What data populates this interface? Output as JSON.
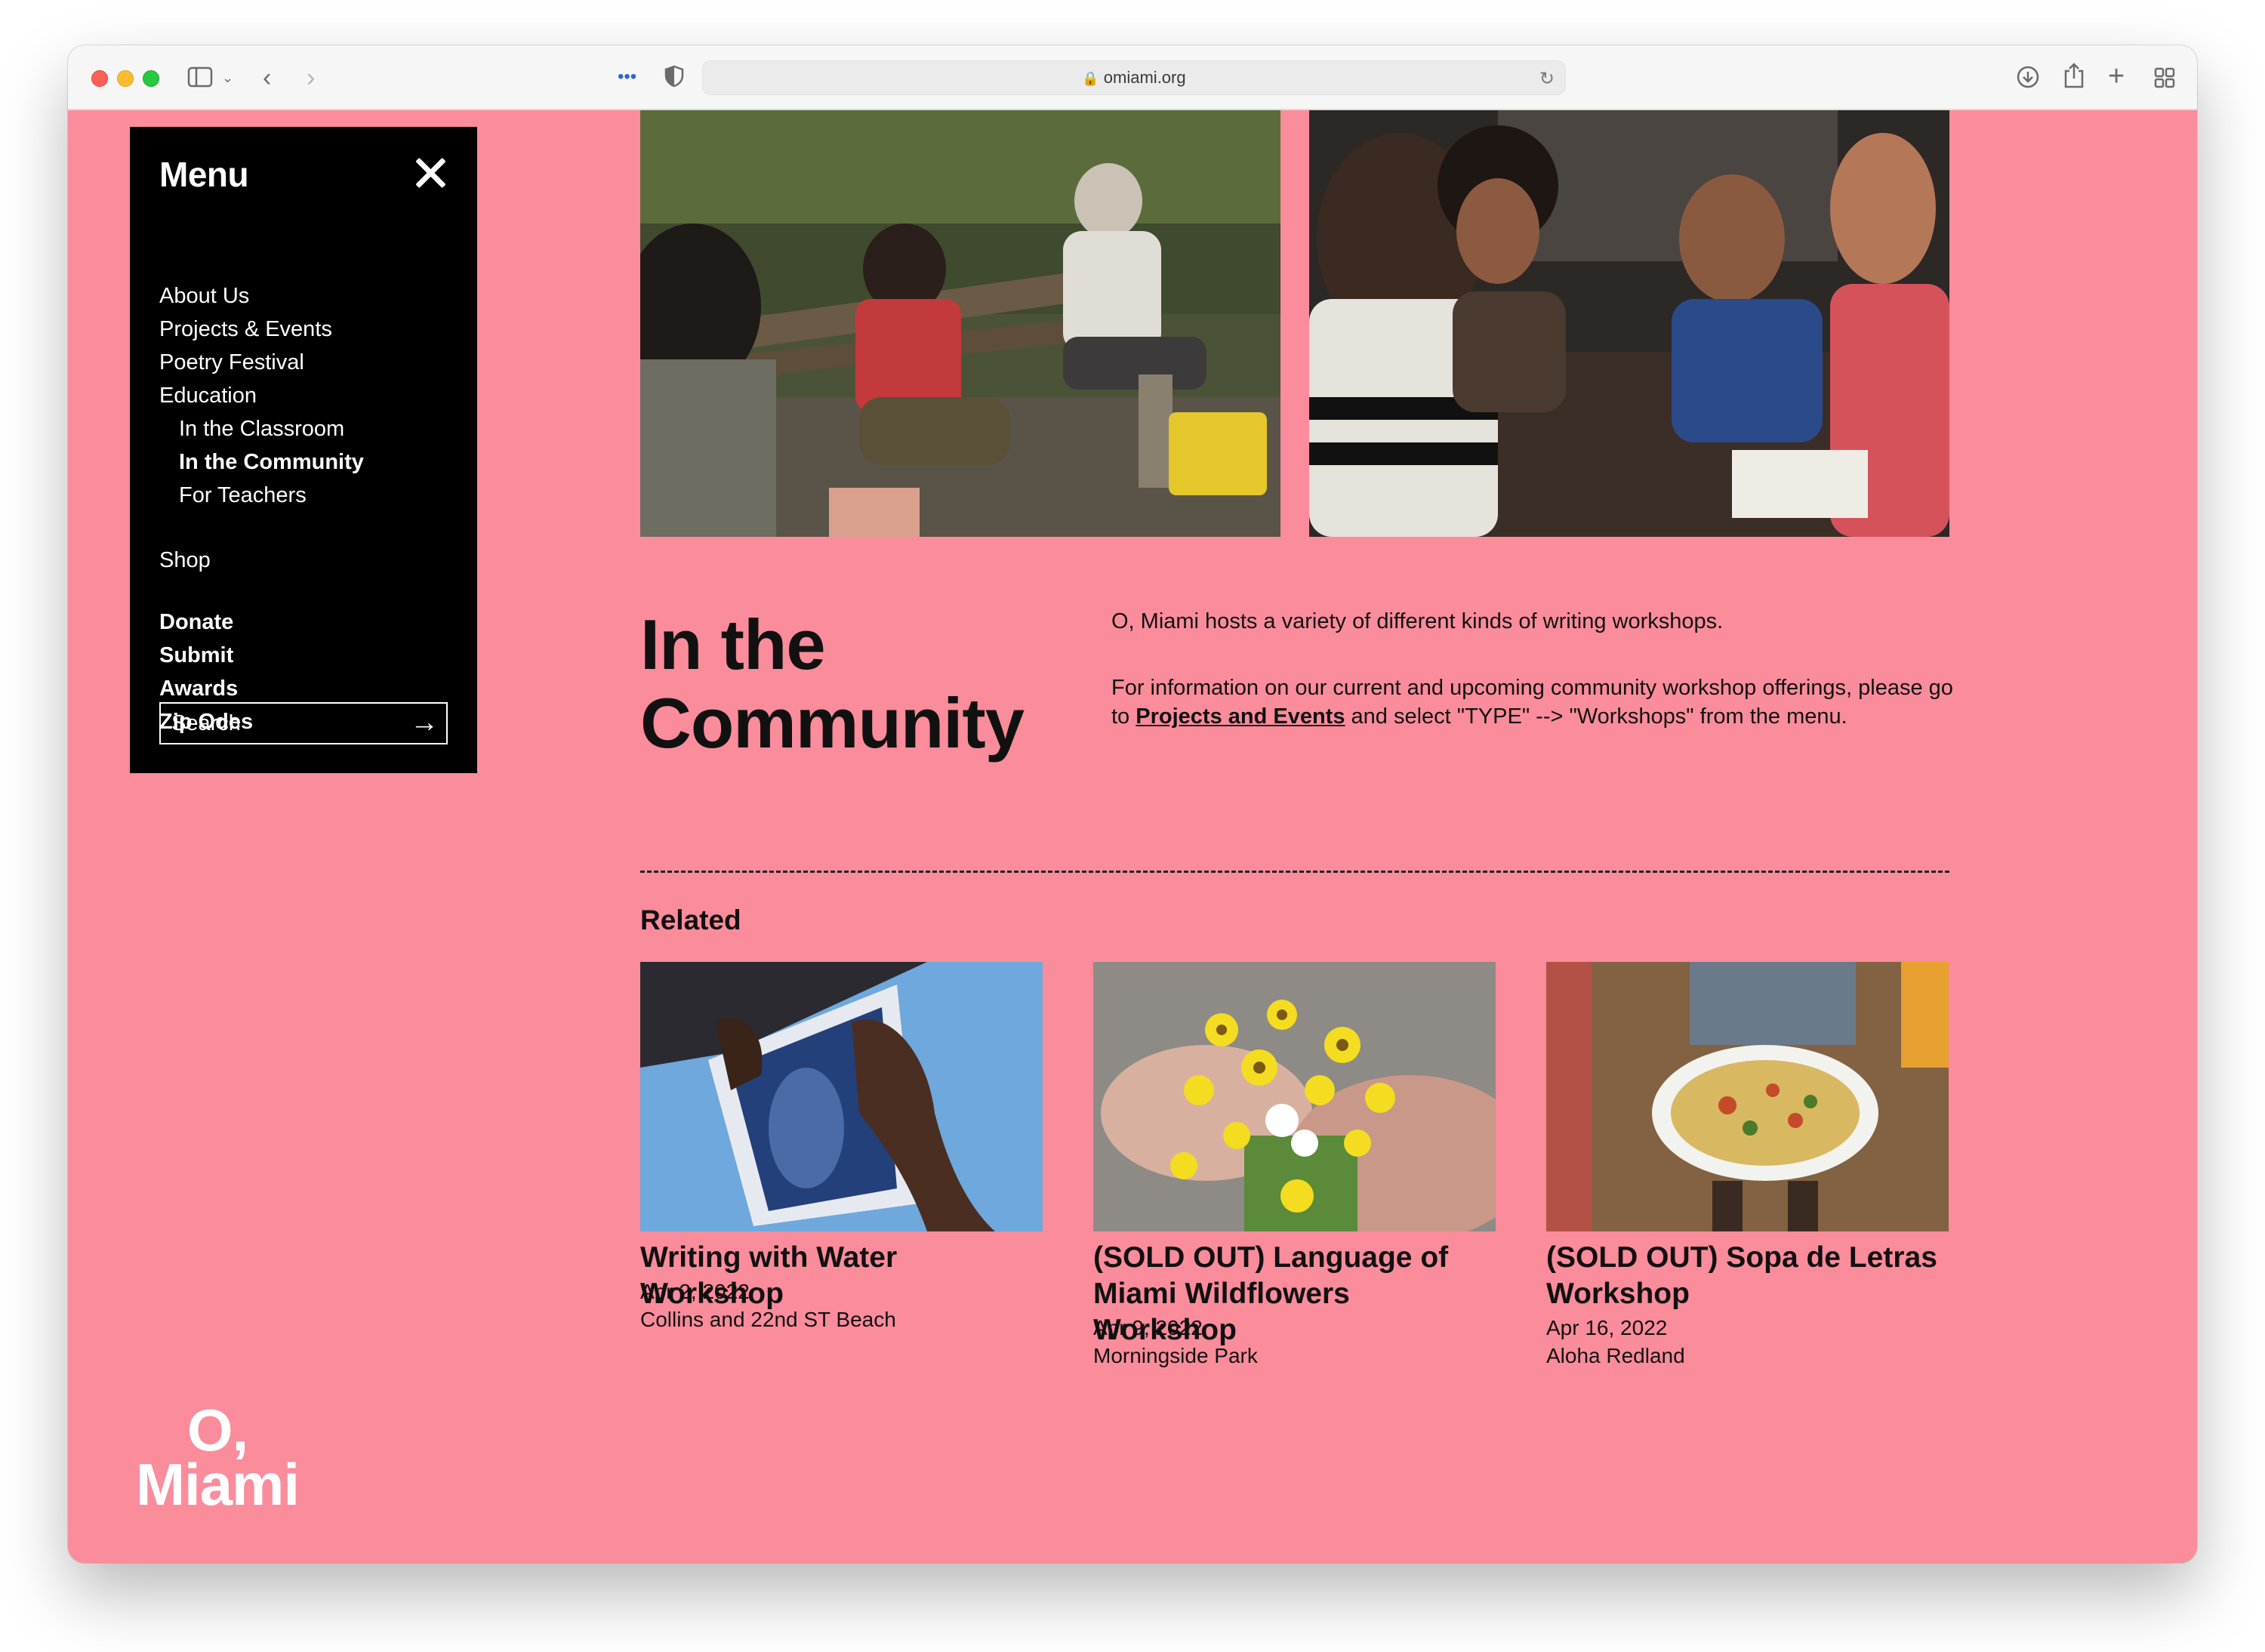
{
  "browser": {
    "url": "omiami.org"
  },
  "menu": {
    "title": "Menu",
    "items": [
      {
        "label": "About Us"
      },
      {
        "label": "Projects & Events"
      },
      {
        "label": "Poetry Festival"
      },
      {
        "label": "Education"
      },
      {
        "label": "In the Classroom"
      },
      {
        "label": "In the Community"
      },
      {
        "label": "For Teachers"
      },
      {
        "label": "Shop"
      },
      {
        "label": "Donate"
      },
      {
        "label": "Submit"
      },
      {
        "label": "Awards"
      },
      {
        "label": "Zip Odes"
      }
    ],
    "search_placeholder": "Search"
  },
  "page": {
    "title": "In the Community",
    "intro_1": "O, Miami hosts a variety of different kinds of writing workshops.",
    "intro_2_before": "For information on our current and upcoming community workshop offerings, please go to ",
    "intro_2_link": "Projects and Events",
    "intro_2_after": " and select \"TYPE\" --> \"Workshops\" from the menu."
  },
  "related": {
    "heading": "Related",
    "cards": [
      {
        "title": "Writing with Water Workshop",
        "date": "Apr 2, 2022",
        "location": "Collins and 22nd ST Beach"
      },
      {
        "title": "(SOLD OUT) Language of Miami Wildflowers Workshop",
        "date": "Apr 9, 2022",
        "location": "Morningside Park"
      },
      {
        "title": "(SOLD OUT) Sopa de Letras Workshop",
        "date": "Apr 16, 2022",
        "location": "Aloha Redland"
      }
    ]
  },
  "logo": {
    "line1": "O,",
    "line2": "Miami"
  },
  "colors": {
    "page_background": "#fb8c9c",
    "menu_background": "#000000",
    "text": "#111111"
  }
}
